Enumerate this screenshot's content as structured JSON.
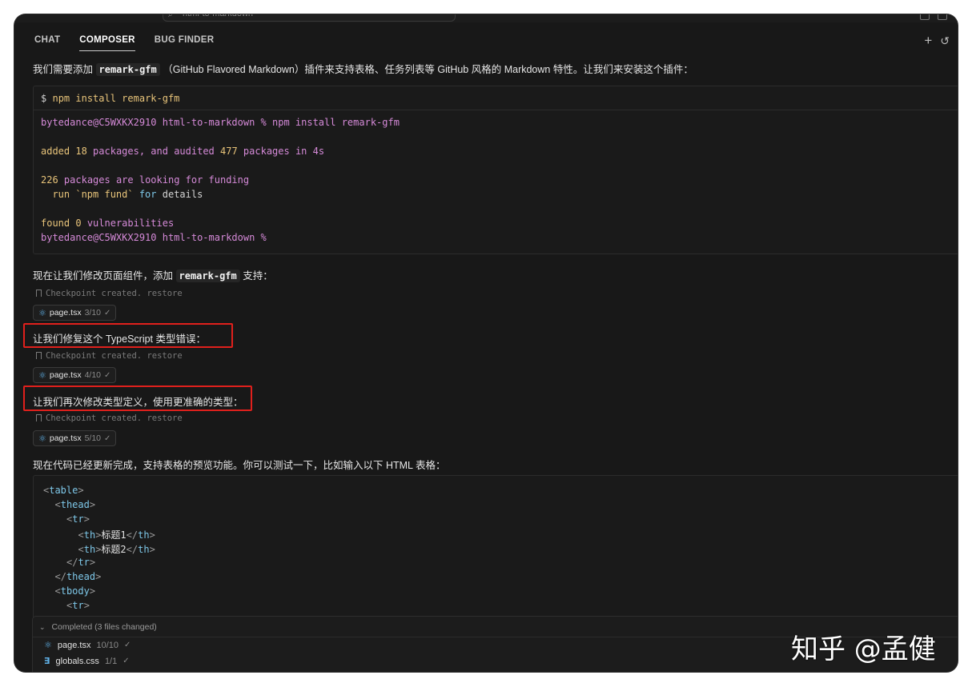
{
  "window": {
    "search_text": "html-to-markdown"
  },
  "tabs": [
    {
      "label": "CHAT",
      "active": false
    },
    {
      "label": "COMPOSER",
      "active": true
    },
    {
      "label": "BUG FINDER",
      "active": false
    }
  ],
  "header_icons": [
    "plus-icon",
    "history-icon"
  ],
  "messages": {
    "m1_before": "我们需要添加",
    "m1_code": "remark-gfm",
    "m1_after": "（GitHub Flavored Markdown）插件来支持表格、任务列表等 GitHub 风格的 Markdown 特性。让我们来安装这个插件：",
    "m2_before": "现在让我们修改页面组件，添加",
    "m2_code": "remark-gfm",
    "m2_after": "支持：",
    "m3": "让我们修复这个 TypeScript 类型错误：",
    "m4": "让我们再次修改类型定义，使用更准确的类型：",
    "m5": "现在代码已经更新完成，支持表格的预览功能。你可以测试一下，比如输入以下 HTML 表格："
  },
  "terminal": {
    "command_prompt": "$",
    "command": "npm install remark-gfm",
    "line1_prompt": "bytedance@C5WXKX2910 html-to-markdown %",
    "line1_cmd": "npm install remark-gfm",
    "line2_a": "added",
    "line2_n1": "18",
    "line2_b": "packages, and audited",
    "line2_n2": "477",
    "line2_c": "packages in 4s",
    "line3_n": "226",
    "line3_text": "packages are looking for funding",
    "line4_a": "  run `npm fund`",
    "line4_b": "for",
    "line4_c": "details",
    "line5_a": "found",
    "line5_n": "0",
    "line5_b": "vulnerabilities",
    "line6_prompt": "bytedance@C5WXKX2910 html-to-markdown %"
  },
  "checkpoints": [
    {
      "text": "Checkpoint created.",
      "restore": "restore"
    },
    {
      "text": "Checkpoint created.",
      "restore": "restore"
    },
    {
      "text": "Checkpoint created.",
      "restore": "restore"
    }
  ],
  "file_chips": [
    {
      "name": "page.tsx",
      "count": "3/10"
    },
    {
      "name": "page.tsx",
      "count": "4/10"
    },
    {
      "name": "page.tsx",
      "count": "5/10"
    }
  ],
  "code_lines": [
    {
      "indent": 0,
      "open": "<",
      "tag": "table",
      "close": ">",
      "text": "",
      "end": ""
    },
    {
      "indent": 1,
      "open": "<",
      "tag": "thead",
      "close": ">",
      "text": "",
      "end": ""
    },
    {
      "indent": 2,
      "open": "<",
      "tag": "tr",
      "close": ">",
      "text": "",
      "end": ""
    },
    {
      "indent": 3,
      "open": "<",
      "tag": "th",
      "close": ">",
      "text": "标题1",
      "end": "</th>"
    },
    {
      "indent": 3,
      "open": "<",
      "tag": "th",
      "close": ">",
      "text": "标题2",
      "end": "</th>"
    },
    {
      "indent": 2,
      "open": "</",
      "tag": "tr",
      "close": ">",
      "text": "",
      "end": ""
    },
    {
      "indent": 1,
      "open": "</",
      "tag": "thead",
      "close": ">",
      "text": "",
      "end": ""
    },
    {
      "indent": 1,
      "open": "<",
      "tag": "tbody",
      "close": ">",
      "text": "",
      "end": ""
    },
    {
      "indent": 2,
      "open": "<",
      "tag": "tr",
      "close": ">",
      "text": "",
      "end": ""
    }
  ],
  "completed": {
    "label": "Completed",
    "summary": "(3 files changed)",
    "files": [
      {
        "name": "page.tsx",
        "count": "10/10",
        "icon": "react-icon"
      },
      {
        "name": "globals.css",
        "count": "1/1",
        "icon": "css-icon"
      }
    ]
  },
  "watermark": "知乎 @孟健",
  "colors": {
    "background": "#181818",
    "highlight_box": "#e0201c",
    "prompt_pink": "#d58ad8",
    "number_yellow": "#e8c47a",
    "keyword_cyan": "#7ec7e8"
  }
}
